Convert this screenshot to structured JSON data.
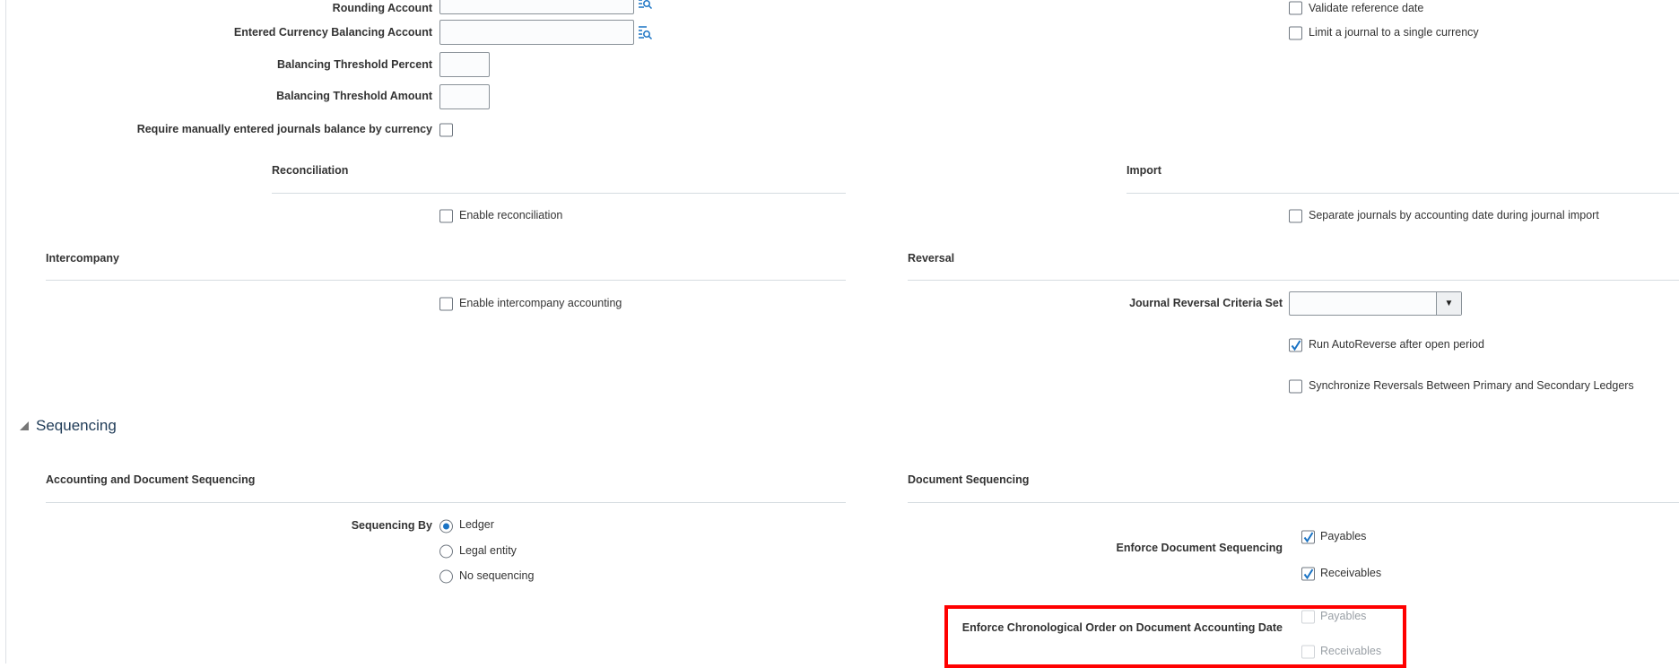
{
  "left": {
    "rounding_account_label": "Rounding Account",
    "entered_currency_label": "Entered Currency Balancing Account",
    "threshold_percent_label": "Balancing Threshold Percent",
    "threshold_amount_label": "Balancing Threshold Amount",
    "require_balance_label": "Require manually entered journals balance by currency",
    "reconciliation": {
      "title": "Reconciliation",
      "enable_label": "Enable reconciliation",
      "checked": false
    },
    "intercompany": {
      "title": "Intercompany",
      "enable_label": "Enable intercompany accounting",
      "checked": false
    }
  },
  "right": {
    "validate_reference_date": "Validate reference date",
    "limit_single_currency": "Limit a journal to a single currency",
    "import": {
      "title": "Import",
      "separate_label": "Separate journals by accounting date during journal import"
    },
    "reversal": {
      "title": "Reversal",
      "criteria_set_label": "Journal Reversal Criteria Set",
      "criteria_set_value": "",
      "run_autoreverse": "Run AutoReverse after open period",
      "run_autoreverse_checked": true,
      "synchronize": "Synchronize Reversals Between Primary and Secondary Ledgers",
      "synchronize_checked": false
    }
  },
  "sequencing": {
    "section_title": "Sequencing",
    "accounting_doc": {
      "title": "Accounting and Document Sequencing",
      "sequencing_by_label": "Sequencing By",
      "options": [
        "Ledger",
        "Legal entity",
        "No sequencing"
      ],
      "selected": "Ledger"
    },
    "document": {
      "title": "Document Sequencing",
      "enforce_label": "Enforce Document Sequencing",
      "enforce_payables": "Payables",
      "enforce_receivables": "Receivables",
      "chrono_label": "Enforce Chronological Order on Document Accounting Date",
      "chrono_payables": "Payables",
      "chrono_receivables": "Receivables"
    }
  },
  "colors": {
    "accent": "#1a73c4",
    "highlight": "#ff0000"
  }
}
